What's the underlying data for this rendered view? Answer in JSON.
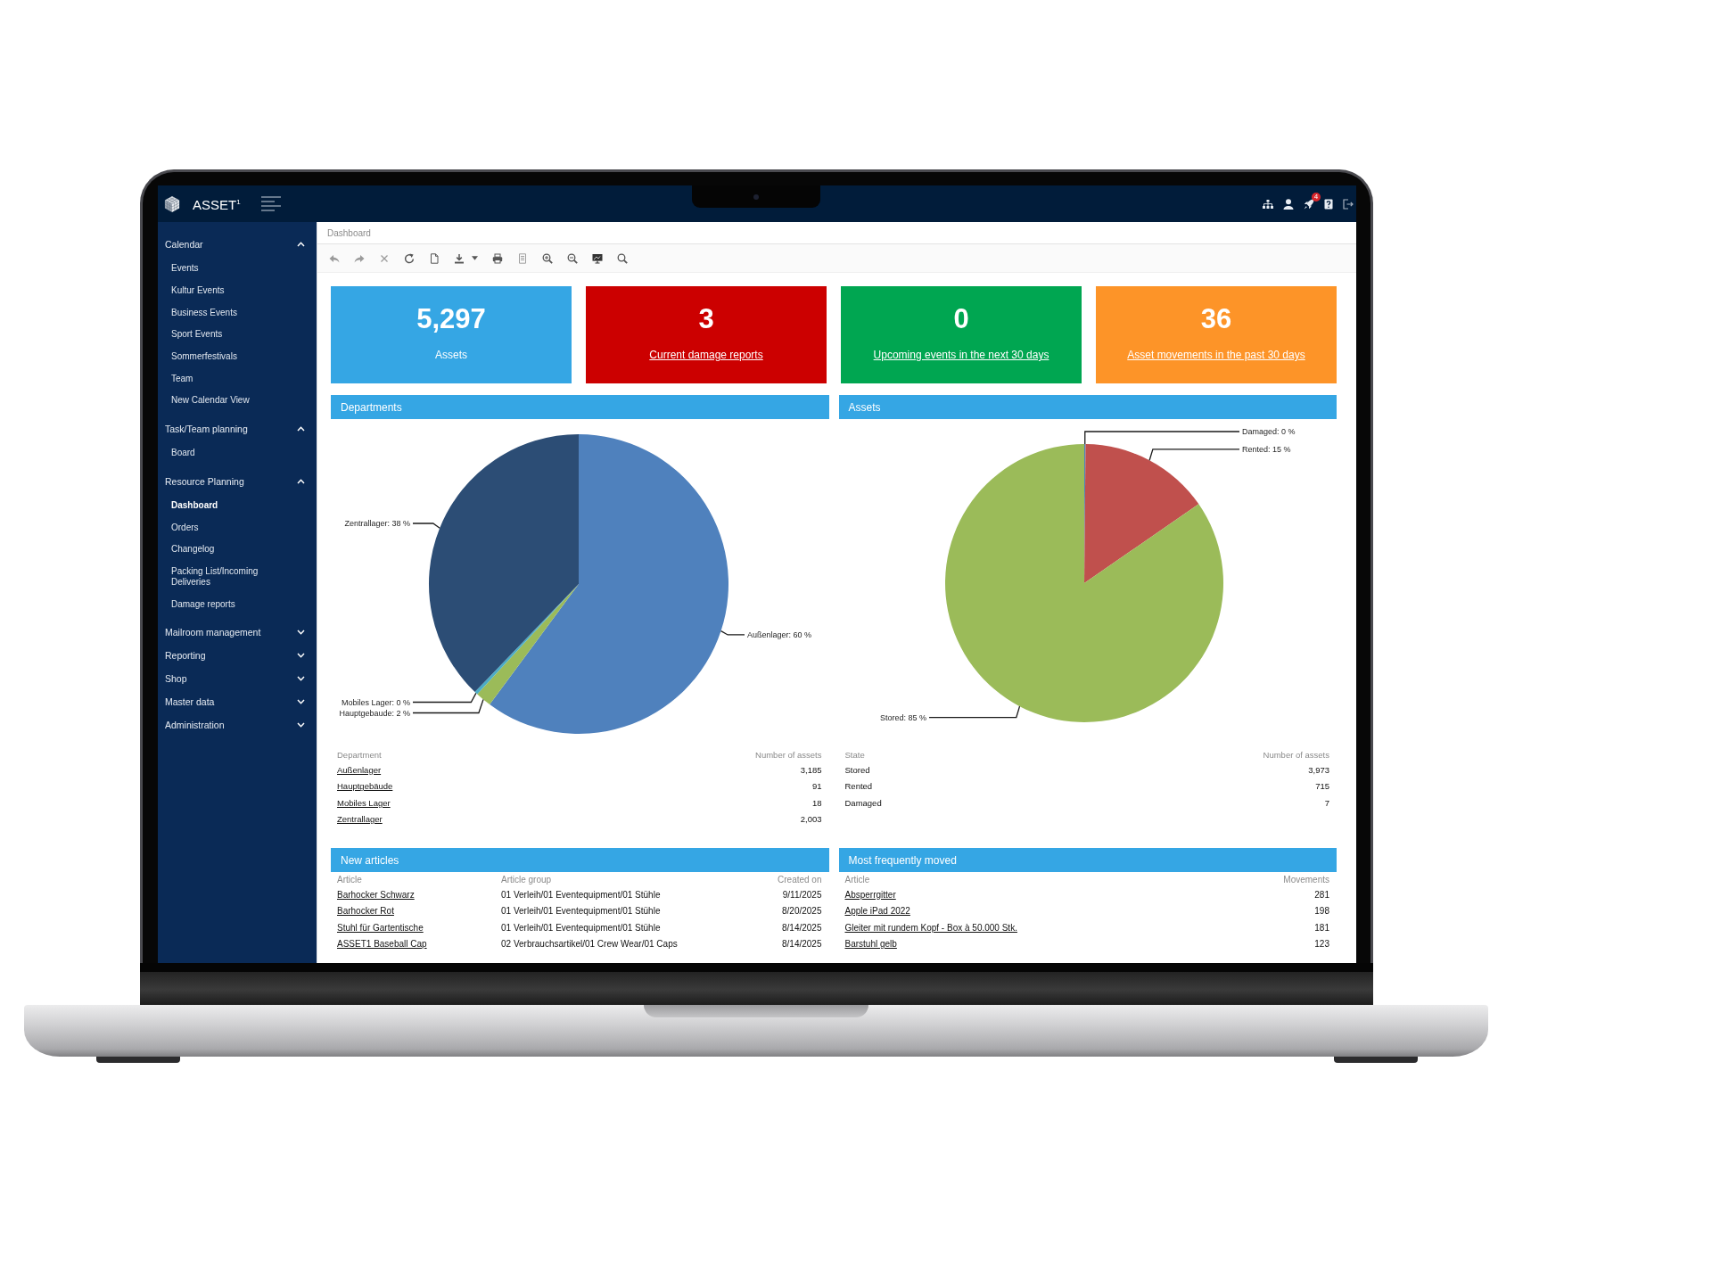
{
  "top_bar": {
    "logo": "ASSET$^{1}$",
    "notification_count": "4"
  },
  "sidebar": {
    "groups": [
      {
        "label": "Calendar",
        "expanded": true,
        "items": [
          {
            "label": "Events",
            "selected": false
          },
          {
            "label": "Kultur Events",
            "selected": false
          },
          {
            "label": "Business Events",
            "selected": false
          },
          {
            "label": "Sport Events",
            "selected": false
          },
          {
            "label": "Sommerfestivals",
            "selected": false
          },
          {
            "label": "Team",
            "selected": false
          },
          {
            "label": "New Calendar View",
            "selected": false
          }
        ]
      },
      {
        "label": "Task/Team planning",
        "expanded": true,
        "items": [
          {
            "label": "Board",
            "selected": false
          }
        ]
      },
      {
        "label": "Resource Planning",
        "expanded": true,
        "items": [
          {
            "label": "Dashboard",
            "selected": true
          },
          {
            "label": "Orders",
            "selected": false
          },
          {
            "label": "Changelog",
            "selected": false
          },
          {
            "label": "Packing List/Incoming Deliveries",
            "selected": false
          },
          {
            "label": "Damage reports",
            "selected": false
          }
        ]
      },
      {
        "label": "Mailroom management",
        "expanded": false
      },
      {
        "label": "Reporting",
        "expanded": false
      },
      {
        "label": "Shop",
        "expanded": false
      },
      {
        "label": "Master data",
        "expanded": false
      },
      {
        "label": "Administration",
        "expanded": false
      }
    ]
  },
  "breadcrumb": "Dashboard",
  "kpi_tiles": [
    {
      "value": "5,297",
      "label": "Assets",
      "kind": "plain",
      "color": "#35a6e4"
    },
    {
      "value": "3",
      "label": "Current damage reports",
      "kind": "link",
      "color": "#cc0000"
    },
    {
      "value": "0",
      "label": "Upcoming events in the next 30 days",
      "kind": "link",
      "color": "#00a651"
    },
    {
      "value": "36",
      "label": "Asset movements in the past 30 days",
      "kind": "link",
      "color": "#fd9428"
    }
  ],
  "panels": [
    {
      "title": "Departments",
      "chart_data": {
        "type": "pie",
        "values": [
          60.13,
          1.72,
          0.34,
          37.81
        ],
        "colors": [
          "#4f81bd",
          "#9bbb59",
          "#4bacc6",
          "#2c4d75"
        ],
        "value_labels": [
          "Außenlager: 60 %",
          "Hauptgebaude: 2 %",
          "Mobiles Lager: 0 %",
          "Zentrallager: 38 %"
        ]
      },
      "table": {
        "columns": [
          {
            "label": "Department",
            "kind": "link"
          },
          {
            "label": "Number of assets",
            "kind": "number"
          }
        ],
        "rows": [
          [
            "Außenlager",
            "3,185"
          ],
          [
            "Hauptgebäude",
            "91"
          ],
          [
            "Mobiles Lager",
            "18"
          ],
          [
            "Zentrallager",
            "2,003"
          ]
        ]
      }
    },
    {
      "title": "Assets",
      "chart_data": {
        "type": "pie",
        "values": [
          0.15,
          15.23,
          84.62
        ],
        "colors": [
          "#4f81bd",
          "#c0504d",
          "#9bbb59"
        ],
        "value_labels": [
          "Damaged: 0 %",
          "Rented: 15 %",
          "Stored: 85 %"
        ]
      },
      "table": {
        "columns": [
          {
            "label": "State",
            "kind": "text"
          },
          {
            "label": "Number of assets",
            "kind": "number"
          }
        ],
        "rows": [
          [
            "Stored",
            "3,973"
          ],
          [
            "Rented",
            "715"
          ],
          [
            "Damaged",
            "7"
          ]
        ]
      }
    },
    {
      "title": "New articles",
      "table": {
        "columns": [
          {
            "label": "Article",
            "kind": "link"
          },
          {
            "label": "Article group",
            "kind": "text"
          },
          {
            "label": "Created on",
            "kind": "number"
          }
        ],
        "rows": [
          [
            "Barhocker Schwarz",
            "01 Verleih/01 Eventequipment/01 Stühle",
            "9/11/2025"
          ],
          [
            "Barhocker Rot",
            "01 Verleih/01 Eventequipment/01 Stühle",
            "8/20/2025"
          ],
          [
            "Stuhl für Gartentische",
            "01 Verleih/01 Eventequipment/01 Stühle",
            "8/14/2025"
          ],
          [
            "ASSET1 Baseball Cap",
            "02 Verbrauchsartikel/01 Crew Wear/01 Caps",
            "8/14/2025"
          ]
        ]
      }
    },
    {
      "title": "Most frequently moved",
      "table": {
        "columns": [
          {
            "label": "Article",
            "kind": "link"
          },
          {
            "label": "Movements",
            "kind": "number"
          }
        ],
        "rows": [
          [
            "Absperrgitter",
            "281"
          ],
          [
            "Apple iPad 2022",
            "198"
          ],
          [
            "Gleiter mit rundem Kopf - Box à 50.000 Stk.",
            "181"
          ],
          [
            "Barstuhl gelb",
            "123"
          ]
        ]
      }
    }
  ]
}
